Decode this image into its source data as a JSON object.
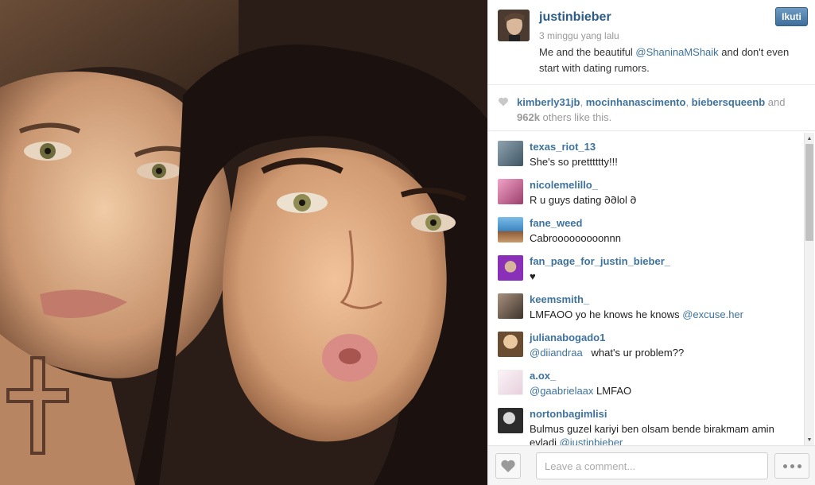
{
  "post": {
    "username": "justinbieber",
    "time_ago": "3 minggu yang lalu",
    "caption_before": "Me and the beautiful ",
    "caption_mention": "@ShaninaMShaik",
    "caption_after": " and don't even start with dating rumors.",
    "follow_label": "Ikuti",
    "avatar_icon": "profile-photo"
  },
  "likes": {
    "users": [
      "kimberly31jb",
      "mocinhanascimento",
      "biebersqueenb"
    ],
    "and_text": "and",
    "count": "962k",
    "others_text": "others like this."
  },
  "comments": [
    {
      "user": "texas_riot_13",
      "text": "She's so pretttttty!!!",
      "avatar_color": "#5a6f7d"
    },
    {
      "user": "nicolemelillo_",
      "text": "R u guys dating 𐐀𐐀lol 𐐀",
      "avatar_color": "#d277a1"
    },
    {
      "user": "fane_weed",
      "text": "Cabrooooooooonnn",
      "avatar_color": "#4a8fc2"
    },
    {
      "user": "fan_page_for_justin_bieber_",
      "text": "♥",
      "avatar_color": "#7a3fb0"
    },
    {
      "user": "keemsmith_",
      "text_before": "LMFAOO yo he knows he knows ",
      "mention": "@excuse.her",
      "avatar_color": "#6b5a4c"
    },
    {
      "user": "julianabogado1",
      "mention": "@diiandraa",
      "text_after": "   what's ur problem??",
      "avatar_color": "#c9a070"
    },
    {
      "user": "a.ox_",
      "mention": "@gaabrielaax",
      "text_after": " LMFAO",
      "avatar_color": "#f0e6ef"
    },
    {
      "user": "nortonbagimlisi",
      "text_before": "Bulmus guzel kariyi ben olsam bende birakmam amin",
      "text_line2_before": "evladi ",
      "mention": "@justinbieber",
      "avatar_color": "#3a3a3a"
    }
  ],
  "footer": {
    "comment_placeholder": "Leave a comment...",
    "like_icon": "heart-icon",
    "more_icon": "more-options-icon"
  },
  "colors": {
    "link": "#3f729b",
    "username": "#2c5b86",
    "follow_button": "#3e6e9b"
  }
}
